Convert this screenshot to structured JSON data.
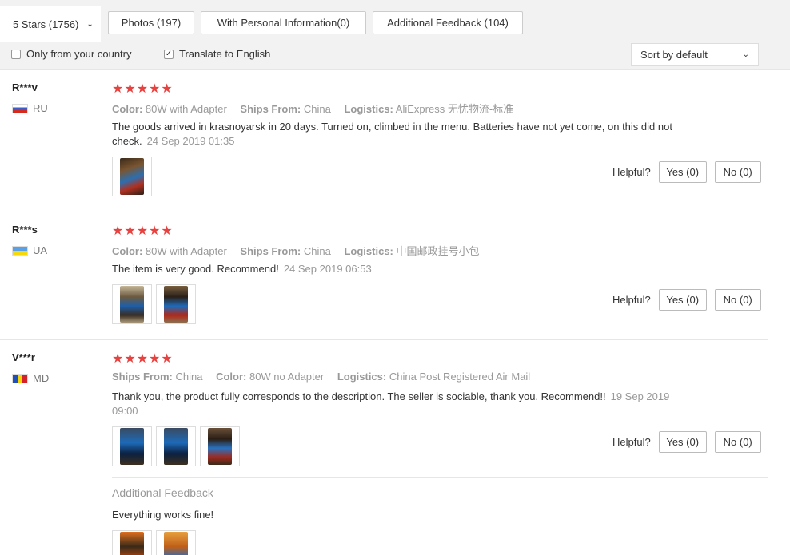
{
  "filters": {
    "star_select": "5 Stars (1756)",
    "photos": "Photos (197)",
    "personal_info": "With Personal Information(0)",
    "additional_feedback": "Additional Feedback (104)",
    "only_country": "Only from your country",
    "only_country_checked": false,
    "translate": "Translate to English",
    "translate_checked": true,
    "sort": "Sort by default"
  },
  "helpful_label": "Helpful?",
  "reviews": [
    {
      "user": "R***v",
      "country": "RU",
      "stars": "★★★★★",
      "attrs": [
        {
          "k": "Color:",
          "v": "80W with Adapter"
        },
        {
          "k": "Ships From:",
          "v": "China"
        },
        {
          "k": "Logistics:",
          "v": "AliExpress 无忧物流-标准"
        }
      ],
      "text": "The goods arrived in krasnoyarsk in 20 days. Turned on, climbed in the menu. Batteries have not yet come, on this did not check.",
      "date": "24 Sep 2019 01:35",
      "yes": "Yes (0)",
      "no": "No (0)"
    },
    {
      "user": "R***s",
      "country": "UA",
      "stars": "★★★★★",
      "attrs": [
        {
          "k": "Color:",
          "v": "80W with Adapter"
        },
        {
          "k": "Ships From:",
          "v": "China"
        },
        {
          "k": "Logistics:",
          "v": "中国邮政挂号小包"
        }
      ],
      "text": "The item is very good. Recommend!",
      "date": "24 Sep 2019 06:53",
      "yes": "Yes (0)",
      "no": "No (0)"
    },
    {
      "user": "V***r",
      "country": "MD",
      "stars": "★★★★★",
      "attrs": [
        {
          "k": "Ships From:",
          "v": "China"
        },
        {
          "k": "Color:",
          "v": "80W no Adapter"
        },
        {
          "k": "Logistics:",
          "v": "China Post Registered Air Mail"
        }
      ],
      "text": "Thank you, the product fully corresponds to the description. The seller is sociable, thank you. Recommend!!",
      "date": "19 Sep 2019 09:00",
      "yes": "Yes (0)",
      "no": "No (0)",
      "additional_title": "Additional Feedback",
      "additional_text": "Everything works fine!"
    }
  ]
}
